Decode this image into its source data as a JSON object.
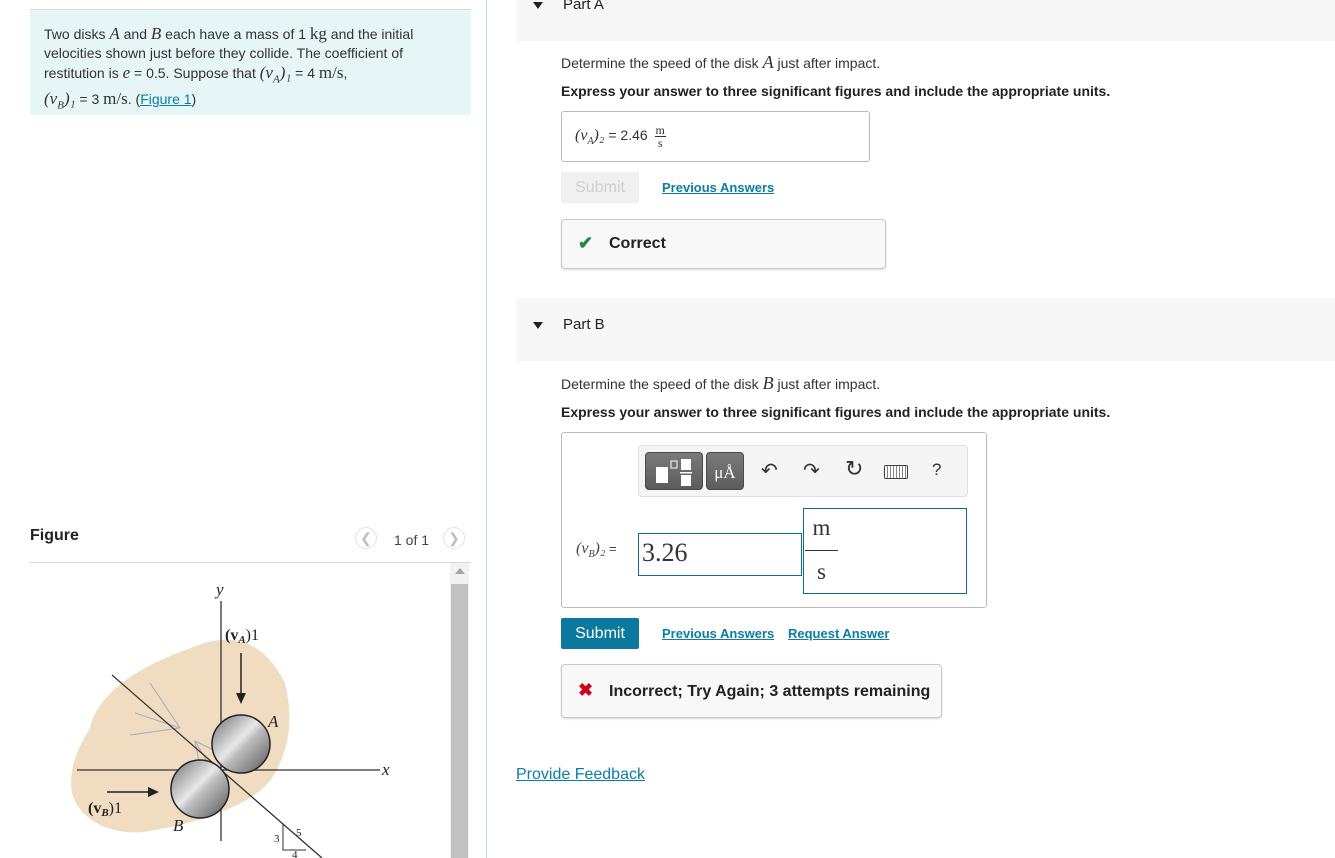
{
  "problem": {
    "text_1": "Two disks ",
    "var_A": "A",
    "text_2": " and ",
    "var_B": "B",
    "text_3": " each have a mass of 1 ",
    "unit_kg": "kg",
    "text_4": " and the initial velocities shown just before they collide. The coefficient of restitution is ",
    "var_e": "e",
    "text_5": " = 0.5. Suppose that ",
    "vA1_label": "(v",
    "vA1_sub": "A",
    "vA1_tail": ")₁",
    "text_6": " = 4 ",
    "unit_ms": "m/s",
    "text_7": ", ",
    "vB1_label": "(v",
    "vB1_sub": "B",
    "vB1_tail": ")₁",
    "text_8": " = 3 ",
    "text_9": ". (",
    "figure_link": "Figure 1",
    "text_10": ")"
  },
  "figure": {
    "title": "Figure",
    "counter": "1 of 1",
    "prev_icon": "chevron-left-icon",
    "next_icon": "chevron-right-icon",
    "labels": {
      "y": "y",
      "x": "x",
      "vA": "(v",
      "vA_sub": "A",
      "vA_tail": ")1",
      "vB": "(v",
      "vB_sub": "B",
      "vB_tail": ")1",
      "A": "A",
      "B": "B",
      "tri_3": "3",
      "tri_4": "4",
      "tri_5": "5"
    }
  },
  "partA": {
    "title": "Part A",
    "question_pre": "Determine the speed of the disk ",
    "question_var": "A",
    "question_post": " just after impact.",
    "instruction": "Express your answer to three significant figures and include the appropriate units.",
    "answer_label": "(v",
    "answer_sub": "A",
    "answer_tail": ")₂",
    "answer_eq": " = ",
    "answer_value": "2.46",
    "unit_num": "m",
    "unit_den": "s",
    "submit_label": "Submit",
    "previous_answers": "Previous Answers",
    "feedback": "Correct",
    "feedback_color": "#1e8a3a"
  },
  "partB": {
    "title": "Part B",
    "question_pre": "Determine the speed of the disk ",
    "question_var": "B",
    "question_post": " just after impact.",
    "instruction": "Express your answer to three significant figures and include the appropriate units.",
    "toolbar": {
      "templates_icon": "fraction-template-icon",
      "units_label": "μÅ",
      "undo_icon": "undo-icon",
      "redo_icon": "redo-icon",
      "reset_icon": "reset-icon",
      "keyboard_icon": "keyboard-icon",
      "help_label": "?"
    },
    "answer_label": "(v",
    "answer_sub": "B",
    "answer_tail": ")₂",
    "answer_eq": " =",
    "answer_value": "3.26",
    "unit_num": "m",
    "unit_den": "s",
    "submit_label": "Submit",
    "previous_answers": "Previous Answers",
    "request_answer": "Request Answer",
    "feedback": "Incorrect; Try Again; 3 attempts remaining",
    "feedback_color": "#d0021b"
  },
  "footer": {
    "provide_feedback": "Provide Feedback"
  },
  "colors": {
    "accent": "#0b789e",
    "link": "#0a7ea4",
    "problem_bg": "#e6f5f6"
  }
}
